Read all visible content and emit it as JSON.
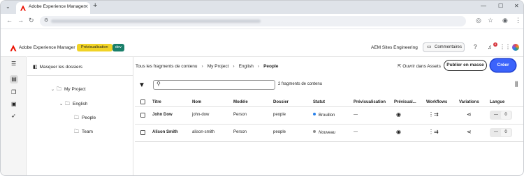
{
  "browser": {
    "tab_title": "Adobe Experience Manager",
    "new_tab": "+",
    "window_controls": {
      "minimize": "—",
      "maximize": "☐",
      "close": "✕"
    }
  },
  "aem": {
    "product_name": "Adobe Experience Manager",
    "env_badge": "Prévisualisation",
    "branch_badge": "dev",
    "org_name": "AEM Sites Engineering",
    "comments_label": "Commentaires",
    "notifications_count": "6",
    "brand_color": "#eb1000",
    "accent_color": "#3b63fb"
  },
  "folders_panel": {
    "toggle_label": "Masquer les dossiers",
    "tree": [
      {
        "label": "My Project",
        "level": 1,
        "expanded": true
      },
      {
        "label": "English",
        "level": 2,
        "expanded": true
      },
      {
        "label": "People",
        "level": 3
      },
      {
        "label": "Team",
        "level": 3
      }
    ]
  },
  "breadcrumb": {
    "items": [
      "Tous les fragments de contenu",
      "My Project",
      "English",
      "People"
    ]
  },
  "actions": {
    "open_assets": "Ouvrir dans Assets",
    "bulk_publish": "Publier en masse",
    "create": "Créer"
  },
  "search": {
    "placeholder": "",
    "result_count": "2 fragments de contenu"
  },
  "table": {
    "columns": [
      "Titre",
      "Nom",
      "Modèle",
      "Dossier",
      "Statut",
      "Prévisualisation",
      "Prévisual...",
      "Workflows",
      "Variations",
      "Langue"
    ],
    "rows": [
      {
        "title": "John Dow",
        "name": "john-dow",
        "model": "Person",
        "folder": "people",
        "status": "Brouillon",
        "status_color": "#2680eb",
        "preview": "—",
        "lang_dash": "—",
        "lang_count": "0"
      },
      {
        "title": "Alison Smith",
        "name": "alison-smith",
        "model": "Person",
        "folder": "people",
        "status": "Nouveau",
        "status_color": "#8e8e8e",
        "preview": "—",
        "lang_dash": "—",
        "lang_count": "0"
      }
    ]
  }
}
